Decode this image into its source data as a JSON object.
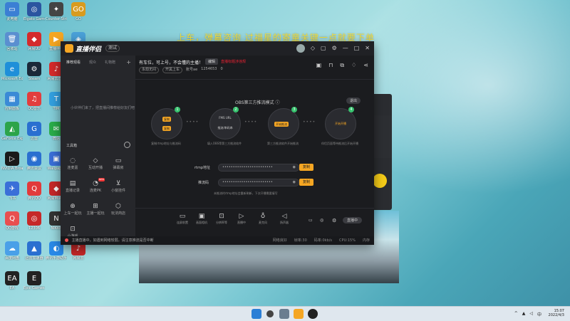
{
  "banner": "上车，弹幕咨询 过福星的寄童关键一点就要下单",
  "desktop_icons": [
    {
      "label": "此电脑",
      "color": "#3b7fd4",
      "glyph": "▭"
    },
    {
      "label": "Elgato Game Capture",
      "color": "#2b55a0",
      "glyph": "◎"
    },
    {
      "label": "Counter-Strike",
      "color": "#444",
      "glyph": "✦"
    },
    {
      "label": "GO",
      "color": "#d89b1f",
      "glyph": "GO"
    },
    {
      "label": "回收站",
      "color": "#5a8fd0",
      "glyph": "🗑"
    },
    {
      "label": "网易UU",
      "color": "#d42b2b",
      "glyph": "◆"
    },
    {
      "label": "直播伴侣",
      "color": "#f5a623",
      "glyph": "▶"
    },
    {
      "label": "Steam",
      "color": "#4aa0d8",
      "glyph": "◈"
    },
    {
      "label": "Microsoft Edge",
      "color": "#1f8fd9",
      "glyph": "e"
    },
    {
      "label": "Steam",
      "color": "#1b2838",
      "glyph": "⚙"
    },
    {
      "label": "网易云音乐",
      "color": "#d62b2b",
      "glyph": "♪"
    },
    {
      "label": "QQ",
      "color": "#e84f4f",
      "glyph": "Q"
    },
    {
      "label": "控制面板",
      "color": "#3a8ad6",
      "glyph": "▦"
    },
    {
      "label": "QQ音乐",
      "color": "#e23d3d",
      "glyph": "♫"
    },
    {
      "label": "TIM",
      "color": "#34a0e0",
      "glyph": "T"
    },
    {
      "label": "WeGame",
      "color": "#f2b632",
      "glyph": "W"
    },
    {
      "label": "GeForce Experience",
      "color": "#2ca44a",
      "glyph": "◭"
    },
    {
      "label": "迅雷",
      "color": "#2a6fd0",
      "glyph": "G"
    },
    {
      "label": "微信",
      "color": "#2aae4a",
      "glyph": "✉"
    },
    {
      "label": "Tencent",
      "color": "#2ca44a",
      "glyph": "✿"
    },
    {
      "label": "NVIDIA Broadcast",
      "color": "#1a1a1a",
      "glyph": "▷"
    },
    {
      "label": "腾讯会议",
      "color": "#2a6fd0",
      "glyph": "◉"
    },
    {
      "label": "Wallpaper",
      "color": "#3a6fd8",
      "glyph": "▣"
    },
    {
      "label": "网易UU加速器",
      "color": "#e03232",
      "glyph": "◎"
    },
    {
      "label": "飞书",
      "color": "#3a6fd8",
      "glyph": "✈"
    },
    {
      "label": "腾讯QQ",
      "color": "#e23a3a",
      "glyph": "Q"
    },
    {
      "label": "网易MuMu",
      "color": "#c62828",
      "glyph": "◆"
    },
    {
      "label": "Apex",
      "color": "#444",
      "glyph": "△"
    },
    {
      "label": "QQ游戏",
      "color": "#e84f4f",
      "glyph": "Q"
    },
    {
      "label": "12306",
      "color": "#c62828",
      "glyph": "◎"
    },
    {
      "label": "NIKKE",
      "color": "#333",
      "glyph": "N"
    },
    {
      "label": "OBS Studio",
      "color": "#333",
      "glyph": "◉"
    },
    {
      "label": "百度网盘",
      "color": "#4aa0e8",
      "glyph": "☁"
    },
    {
      "label": "迅雷加速器",
      "color": "#2a6fd0",
      "glyph": "▲"
    },
    {
      "label": "腾讯手游助手",
      "color": "#2a8ae8",
      "glyph": "◐"
    },
    {
      "label": "网易云",
      "color": "#c62828",
      "glyph": "♪"
    },
    {
      "label": "EA",
      "color": "#222",
      "glyph": "EA"
    },
    {
      "label": "Epic Games Launcher",
      "color": "#222",
      "glyph": "E"
    }
  ],
  "app": {
    "brand": "直播伴侣",
    "test_tag": "测试",
    "left_tabs": [
      "推荐观看",
      "观众",
      "礼物赠"
    ],
    "left_empty": "小伙伴们来了，把直播间推荐给好友们吧",
    "tools_title": "工具箱",
    "tools": [
      {
        "label": "连麦嘉",
        "icon": "◌"
      },
      {
        "label": "互动开播",
        "icon": "◇"
      },
      {
        "label": "弹幕房",
        "icon": "▭"
      },
      {
        "label": "直播记录",
        "icon": "▤"
      },
      {
        "label": "连麦PK",
        "icon": "◔",
        "badge": "NEW"
      },
      {
        "label": "小窗挂件",
        "icon": "⊻"
      },
      {
        "label": "上车一起玩",
        "icon": "⊕"
      },
      {
        "label": "主播一起玩",
        "icon": "⊞"
      },
      {
        "label": "玩法商店",
        "icon": "⬡"
      },
      {
        "label": "小游戏",
        "icon": "⊡"
      }
    ],
    "stream_title": "有车位，可上号，不会懂的主播！",
    "edit_label": "编辑",
    "warn": "直播标题涉违规",
    "sub_info": [
      "永劫无间",
      "开黑上车",
      "账号ae",
      "1254653",
      "0"
    ],
    "obs_mode": "OBS第三方推流模式",
    "exit_label": "退出",
    "steps": [
      {
        "badge": "1",
        "buttons": [
          "复制",
          "复制"
        ],
        "desc": "复制rtmp地址与推流码"
      },
      {
        "badge": "2",
        "text": "FMS URL",
        "text2": "推流/串码串",
        "desc": "填入OBS等第三方推流软件"
      },
      {
        "badge": "3",
        "buttons": [
          "开始推流"
        ],
        "desc": "第三方推流软件开始推流"
      },
      {
        "badge": "4",
        "buttons": [
          "开始开播"
        ],
        "desc": "伴侣页面等待推流后开始开播"
      }
    ],
    "rtmp_label": "rtmp地址",
    "rtmp_value": "••••••••••••••••••••••••",
    "key_label": "推流码",
    "key_value": "••••••••••••••••••••••••",
    "copy_label": "复制",
    "hint": "未推流时rtmp地址会重新刷新，下次开播需要填写",
    "bottom_buttons": [
      {
        "label": "连屏前置",
        "icon": "▭"
      },
      {
        "label": "画面相机",
        "icon": "▣"
      },
      {
        "label": "分辨率等",
        "icon": "⊡"
      },
      {
        "label": "直播中",
        "icon": "▷"
      },
      {
        "label": "麦克风",
        "icon": "♁"
      },
      {
        "label": "扬声器",
        "icon": "◁"
      }
    ],
    "live_label": "直播中",
    "notice": "主播直播中，如遇到网络较弱，请注意推流是否中断",
    "notice_right": [
      "网络良好",
      "帧率:30",
      "码率:0kb/s",
      "CPU:15%",
      "内存"
    ]
  },
  "taskbar": {
    "time": "15:07",
    "date": "2022/4/3"
  }
}
